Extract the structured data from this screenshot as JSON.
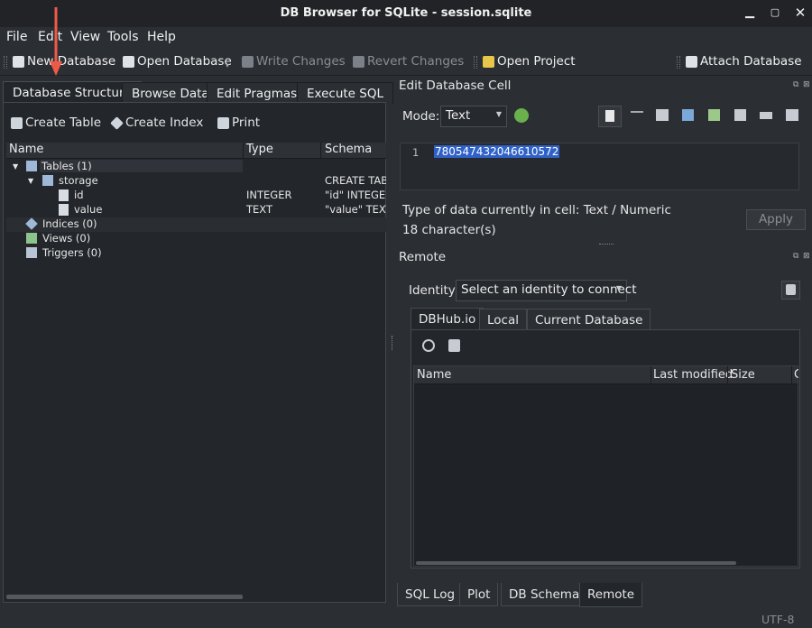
{
  "window": {
    "title": "DB Browser for SQLite - session.sqlite"
  },
  "menu": [
    "File",
    "Edit",
    "View",
    "Tools",
    "Help"
  ],
  "toolbar": {
    "new_database": "New Database",
    "open_database": "Open Database",
    "write_changes": "Write Changes",
    "revert_changes": "Revert Changes",
    "open_project": "Open Project",
    "attach_database": "Attach Database"
  },
  "left_tabs": [
    "Database Structure",
    "Browse Data",
    "Edit Pragmas",
    "Execute SQL"
  ],
  "structure_actions": {
    "create_table": "Create Table",
    "create_index": "Create Index",
    "print": "Print"
  },
  "tree": {
    "columns": [
      "Name",
      "Type",
      "Schema"
    ],
    "rows": [
      {
        "name": "Tables (1)",
        "type": "",
        "schema": ""
      },
      {
        "name": "storage",
        "type": "",
        "schema": "CREATE TABL"
      },
      {
        "name": "id",
        "type": "INTEGER",
        "schema": "\"id\" INTEGER"
      },
      {
        "name": "value",
        "type": "TEXT",
        "schema": "\"value\" TEXT"
      },
      {
        "name": "Indices (0)",
        "type": "",
        "schema": ""
      },
      {
        "name": "Views (0)",
        "type": "",
        "schema": ""
      },
      {
        "name": "Triggers (0)",
        "type": "",
        "schema": ""
      }
    ]
  },
  "edit_cell": {
    "title": "Edit Database Cell",
    "mode_label": "Mode:",
    "mode_value": "Text",
    "line_number": "1",
    "cell_value": "780547432046610572",
    "type_info": "Type of data currently in cell: Text / Numeric",
    "char_count": "18 character(s)",
    "apply_label": "Apply"
  },
  "remote": {
    "title": "Remote",
    "identity_label": "Identity",
    "identity_value": "Select an identity to connect",
    "tabs": [
      "DBHub.io",
      "Local",
      "Current Database"
    ],
    "columns": [
      "Name",
      "Last modified",
      "Size",
      "C"
    ]
  },
  "bottom_tabs": [
    "SQL Log",
    "Plot",
    "DB Schema",
    "Remote"
  ],
  "status": {
    "encoding": "UTF-8"
  },
  "colors": {
    "background": "#2b2e33",
    "selection": "#2f61c7",
    "annotation_arrow": "#ef5a47"
  }
}
